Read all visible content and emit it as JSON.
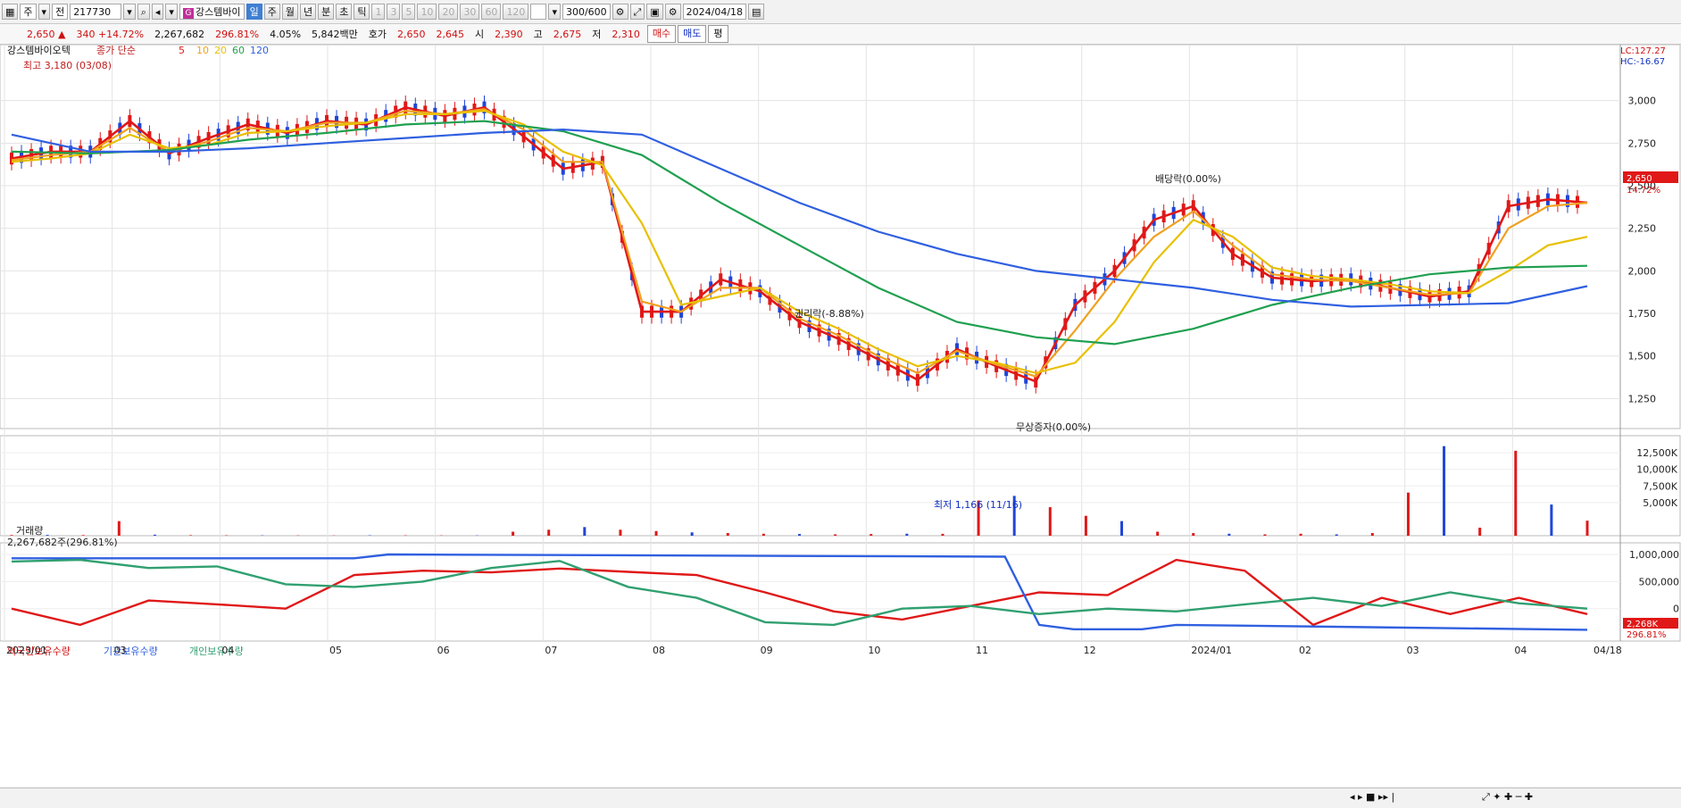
{
  "toolbar": {
    "market": "주",
    "chart_mode": "전",
    "code": "217730",
    "stock_name": "강스템바이",
    "period_buttons": [
      "일",
      "주",
      "월",
      "년",
      "분",
      "초",
      "틱"
    ],
    "minute_buttons": [
      "1",
      "3",
      "5",
      "10",
      "20",
      "30",
      "60",
      "120"
    ],
    "count": "300/600",
    "date": "2024/04/18"
  },
  "quote": {
    "price": "2,650",
    "change": "340",
    "change_pct": "+14.72%",
    "volume": "2,267,682",
    "volume_pct": "296.81%",
    "turnover": "4.05%",
    "amount": "5,842백만",
    "ask_label": "호가",
    "ask": "2,650",
    "bid": "2,645",
    "open_label": "시",
    "open": "2,390",
    "high_label": "고",
    "high": "2,675",
    "low_label": "저",
    "low": "2,310",
    "buy_button": "매수",
    "sell_button": "매도",
    "eval_button": "평"
  },
  "price_panel": {
    "name": "강스템바이오텍",
    "ma_label": "종가 단순",
    "ma_periods": [
      "5",
      "10",
      "20",
      "60",
      "120"
    ],
    "high_annotation": "최고 3,180 (03/08)",
    "low_annotation": "최저 1,166 (11/16)",
    "lc": "LC:127.27",
    "hc": "HC:-16.67",
    "price_tag": "2,650",
    "pct_tag": "14.72%",
    "events": [
      "권리락(-8.88%)",
      "무상증자(0.00%)",
      "배당락(0.00%)"
    ]
  },
  "volume_panel": {
    "title": "거래량",
    "value": "2,267,682주(296.81%)",
    "tag": "2,268K",
    "pct_tag": "296.81%"
  },
  "holding_panel": {
    "legend": [
      "외국인보유수량",
      "기관보유수량",
      "개인보유수량"
    ]
  },
  "colors": {
    "up": "#e01818",
    "down": "#1f45d8",
    "ma5": "#e01818",
    "ma10": "#f0a020",
    "ma20": "#e8c000",
    "ma60": "#20a050",
    "ma120": "#3060e0",
    "foreign": "#e01818",
    "institution": "#3060e0",
    "individual": "#30a070"
  },
  "chart_data": [
    {
      "type": "candlestick",
      "title": "강스템바이오텍",
      "ylim": [
        1100,
        3250
      ],
      "yticks": [
        "1,250",
        "1,500",
        "1,750",
        "2,000",
        "2,250",
        "2,500",
        "2,750",
        "3,000"
      ],
      "x_tick_labels": [
        "2023/01",
        "03",
        "04",
        "05",
        "06",
        "07",
        "08",
        "09",
        "10",
        "11",
        "12",
        "2024/01",
        "02",
        "03",
        "04",
        "04/18"
      ],
      "series": [
        {
          "name": "5",
          "points": [
            [
              0,
              2660
            ],
            [
              1,
              2700
            ],
            [
              2,
              2700
            ],
            [
              3,
              2880
            ],
            [
              4,
              2690
            ],
            [
              5,
              2780
            ],
            [
              6,
              2860
            ],
            [
              7,
              2810
            ],
            [
              8,
              2880
            ],
            [
              9,
              2860
            ],
            [
              10,
              2960
            ],
            [
              11,
              2910
            ],
            [
              12,
              2960
            ],
            [
              13,
              2790
            ],
            [
              14,
              2600
            ],
            [
              15,
              2640
            ],
            [
              16,
              1760
            ],
            [
              17,
              1760
            ],
            [
              18,
              1950
            ],
            [
              19,
              1880
            ],
            [
              20,
              1700
            ],
            [
              21,
              1600
            ],
            [
              22,
              1480
            ],
            [
              23,
              1360
            ],
            [
              24,
              1540
            ],
            [
              25,
              1440
            ],
            [
              26,
              1350
            ],
            [
              27,
              1800
            ],
            [
              28,
              2000
            ],
            [
              29,
              2300
            ],
            [
              30,
              2380
            ],
            [
              31,
              2100
            ],
            [
              32,
              1960
            ],
            [
              33,
              1940
            ],
            [
              34,
              1950
            ],
            [
              35,
              1900
            ],
            [
              36,
              1850
            ],
            [
              37,
              1880
            ],
            [
              38,
              2380
            ],
            [
              39,
              2420
            ],
            [
              40,
              2400
            ]
          ]
        },
        {
          "name": "10",
          "points": [
            [
              0,
              2650
            ],
            [
              1,
              2680
            ],
            [
              2,
              2700
            ],
            [
              3,
              2840
            ],
            [
              4,
              2700
            ],
            [
              5,
              2760
            ],
            [
              6,
              2840
            ],
            [
              7,
              2820
            ],
            [
              8,
              2870
            ],
            [
              9,
              2870
            ],
            [
              10,
              2940
            ],
            [
              11,
              2920
            ],
            [
              12,
              2950
            ],
            [
              13,
              2830
            ],
            [
              14,
              2640
            ],
            [
              15,
              2640
            ],
            [
              16,
              1820
            ],
            [
              17,
              1760
            ],
            [
              18,
              1900
            ],
            [
              19,
              1900
            ],
            [
              20,
              1720
            ],
            [
              21,
              1620
            ],
            [
              22,
              1500
            ],
            [
              23,
              1400
            ],
            [
              24,
              1530
            ],
            [
              25,
              1450
            ],
            [
              26,
              1380
            ],
            [
              27,
              1650
            ],
            [
              28,
              1950
            ],
            [
              29,
              2200
            ],
            [
              30,
              2350
            ],
            [
              31,
              2150
            ],
            [
              32,
              1980
            ],
            [
              33,
              1950
            ],
            [
              34,
              1940
            ],
            [
              35,
              1900
            ],
            [
              36,
              1860
            ],
            [
              37,
              1870
            ],
            [
              38,
              2250
            ],
            [
              39,
              2380
            ],
            [
              40,
              2400
            ]
          ]
        },
        {
          "name": "20",
          "points": [
            [
              0,
              2640
            ],
            [
              1,
              2660
            ],
            [
              2,
              2690
            ],
            [
              3,
              2800
            ],
            [
              4,
              2720
            ],
            [
              5,
              2740
            ],
            [
              6,
              2810
            ],
            [
              7,
              2820
            ],
            [
              8,
              2850
            ],
            [
              9,
              2870
            ],
            [
              10,
              2920
            ],
            [
              11,
              2920
            ],
            [
              12,
              2940
            ],
            [
              13,
              2860
            ],
            [
              14,
              2700
            ],
            [
              15,
              2620
            ],
            [
              16,
              2280
            ],
            [
              17,
              1800
            ],
            [
              18,
              1850
            ],
            [
              19,
              1900
            ],
            [
              20,
              1760
            ],
            [
              21,
              1660
            ],
            [
              22,
              1540
            ],
            [
              23,
              1440
            ],
            [
              24,
              1500
            ],
            [
              25,
              1460
            ],
            [
              26,
              1400
            ],
            [
              27,
              1460
            ],
            [
              28,
              1700
            ],
            [
              29,
              2050
            ],
            [
              30,
              2300
            ],
            [
              31,
              2200
            ],
            [
              32,
              2020
            ],
            [
              33,
              1970
            ],
            [
              34,
              1950
            ],
            [
              35,
              1920
            ],
            [
              36,
              1880
            ],
            [
              37,
              1870
            ],
            [
              38,
              2000
            ],
            [
              39,
              2150
            ],
            [
              40,
              2200
            ]
          ]
        },
        {
          "name": "60",
          "points": [
            [
              0,
              2700
            ],
            [
              2,
              2690
            ],
            [
              4,
              2710
            ],
            [
              6,
              2770
            ],
            [
              8,
              2810
            ],
            [
              10,
              2860
            ],
            [
              12,
              2880
            ],
            [
              14,
              2820
            ],
            [
              16,
              2680
            ],
            [
              18,
              2400
            ],
            [
              20,
              2150
            ],
            [
              22,
              1900
            ],
            [
              24,
              1700
            ],
            [
              26,
              1610
            ],
            [
              28,
              1570
            ],
            [
              30,
              1660
            ],
            [
              32,
              1800
            ],
            [
              34,
              1900
            ],
            [
              36,
              1980
            ],
            [
              38,
              2020
            ],
            [
              40,
              2030
            ]
          ]
        },
        {
          "name": "120",
          "points": [
            [
              0,
              2800
            ],
            [
              2,
              2700
            ],
            [
              4,
              2700
            ],
            [
              6,
              2720
            ],
            [
              8,
              2750
            ],
            [
              10,
              2780
            ],
            [
              12,
              2810
            ],
            [
              14,
              2830
            ],
            [
              16,
              2800
            ],
            [
              18,
              2600
            ],
            [
              20,
              2400
            ],
            [
              22,
              2230
            ],
            [
              24,
              2100
            ],
            [
              26,
              2000
            ],
            [
              28,
              1950
            ],
            [
              30,
              1900
            ],
            [
              32,
              1830
            ],
            [
              34,
              1790
            ],
            [
              36,
              1800
            ],
            [
              38,
              1810
            ],
            [
              40,
              1910
            ]
          ]
        }
      ]
    },
    {
      "type": "bar",
      "title": "거래량",
      "yticks": [
        "5,000K",
        "7,500K",
        "10,000K",
        "12,500K"
      ],
      "values": [
        100,
        120,
        90,
        2200,
        150,
        80,
        60,
        50,
        40,
        30,
        60,
        50,
        40,
        40,
        600,
        900,
        1300,
        900,
        700,
        500,
        400,
        300,
        250,
        200,
        250,
        300,
        280,
        5300,
        6000,
        4300,
        3000,
        2200,
        600,
        400,
        300,
        200,
        300,
        200,
        400,
        6500,
        13500,
        1200,
        12800,
        4700,
        2268
      ]
    },
    {
      "type": "line",
      "title": "외국인보유수량",
      "yticks": [
        "0",
        "500,000",
        "1,000,000"
      ],
      "series": [
        {
          "name": "외국인보유수량",
          "points": [
            [
              0,
              0
            ],
            [
              2,
              -300000
            ],
            [
              4,
              150000
            ],
            [
              6,
              80000
            ],
            [
              8,
              0
            ],
            [
              10,
              620000
            ],
            [
              12,
              700000
            ],
            [
              14,
              670000
            ],
            [
              16,
              740000
            ],
            [
              18,
              680000
            ],
            [
              20,
              620000
            ],
            [
              22,
              300000
            ],
            [
              24,
              -50000
            ],
            [
              26,
              -200000
            ],
            [
              28,
              50000
            ],
            [
              30,
              300000
            ],
            [
              32,
              250000
            ],
            [
              34,
              900000
            ],
            [
              36,
              700000
            ],
            [
              38,
              -300000
            ],
            [
              40,
              200000
            ],
            [
              42,
              -100000
            ],
            [
              44,
              200000
            ],
            [
              46,
              -100000
            ]
          ]
        },
        {
          "name": "기관보유수량",
          "points": [
            [
              0,
              930000
            ],
            [
              10,
              930000
            ],
            [
              11,
              1000000
            ],
            [
              29,
              960000
            ],
            [
              30,
              -300000
            ],
            [
              31,
              -380000
            ],
            [
              33,
              -380000
            ],
            [
              34,
              -300000
            ],
            [
              46,
              -390000
            ]
          ]
        },
        {
          "name": "개인보유수량",
          "points": [
            [
              0,
              870000
            ],
            [
              2,
              900000
            ],
            [
              4,
              750000
            ],
            [
              6,
              780000
            ],
            [
              8,
              450000
            ],
            [
              10,
              400000
            ],
            [
              12,
              500000
            ],
            [
              14,
              750000
            ],
            [
              16,
              880000
            ],
            [
              18,
              400000
            ],
            [
              20,
              200000
            ],
            [
              22,
              -250000
            ],
            [
              24,
              -300000
            ],
            [
              26,
              0
            ],
            [
              28,
              50000
            ],
            [
              30,
              -100000
            ],
            [
              32,
              0
            ],
            [
              34,
              -50000
            ],
            [
              36,
              80000
            ],
            [
              38,
              200000
            ],
            [
              40,
              50000
            ],
            [
              42,
              300000
            ],
            [
              44,
              100000
            ],
            [
              46,
              0
            ]
          ]
        }
      ]
    }
  ]
}
